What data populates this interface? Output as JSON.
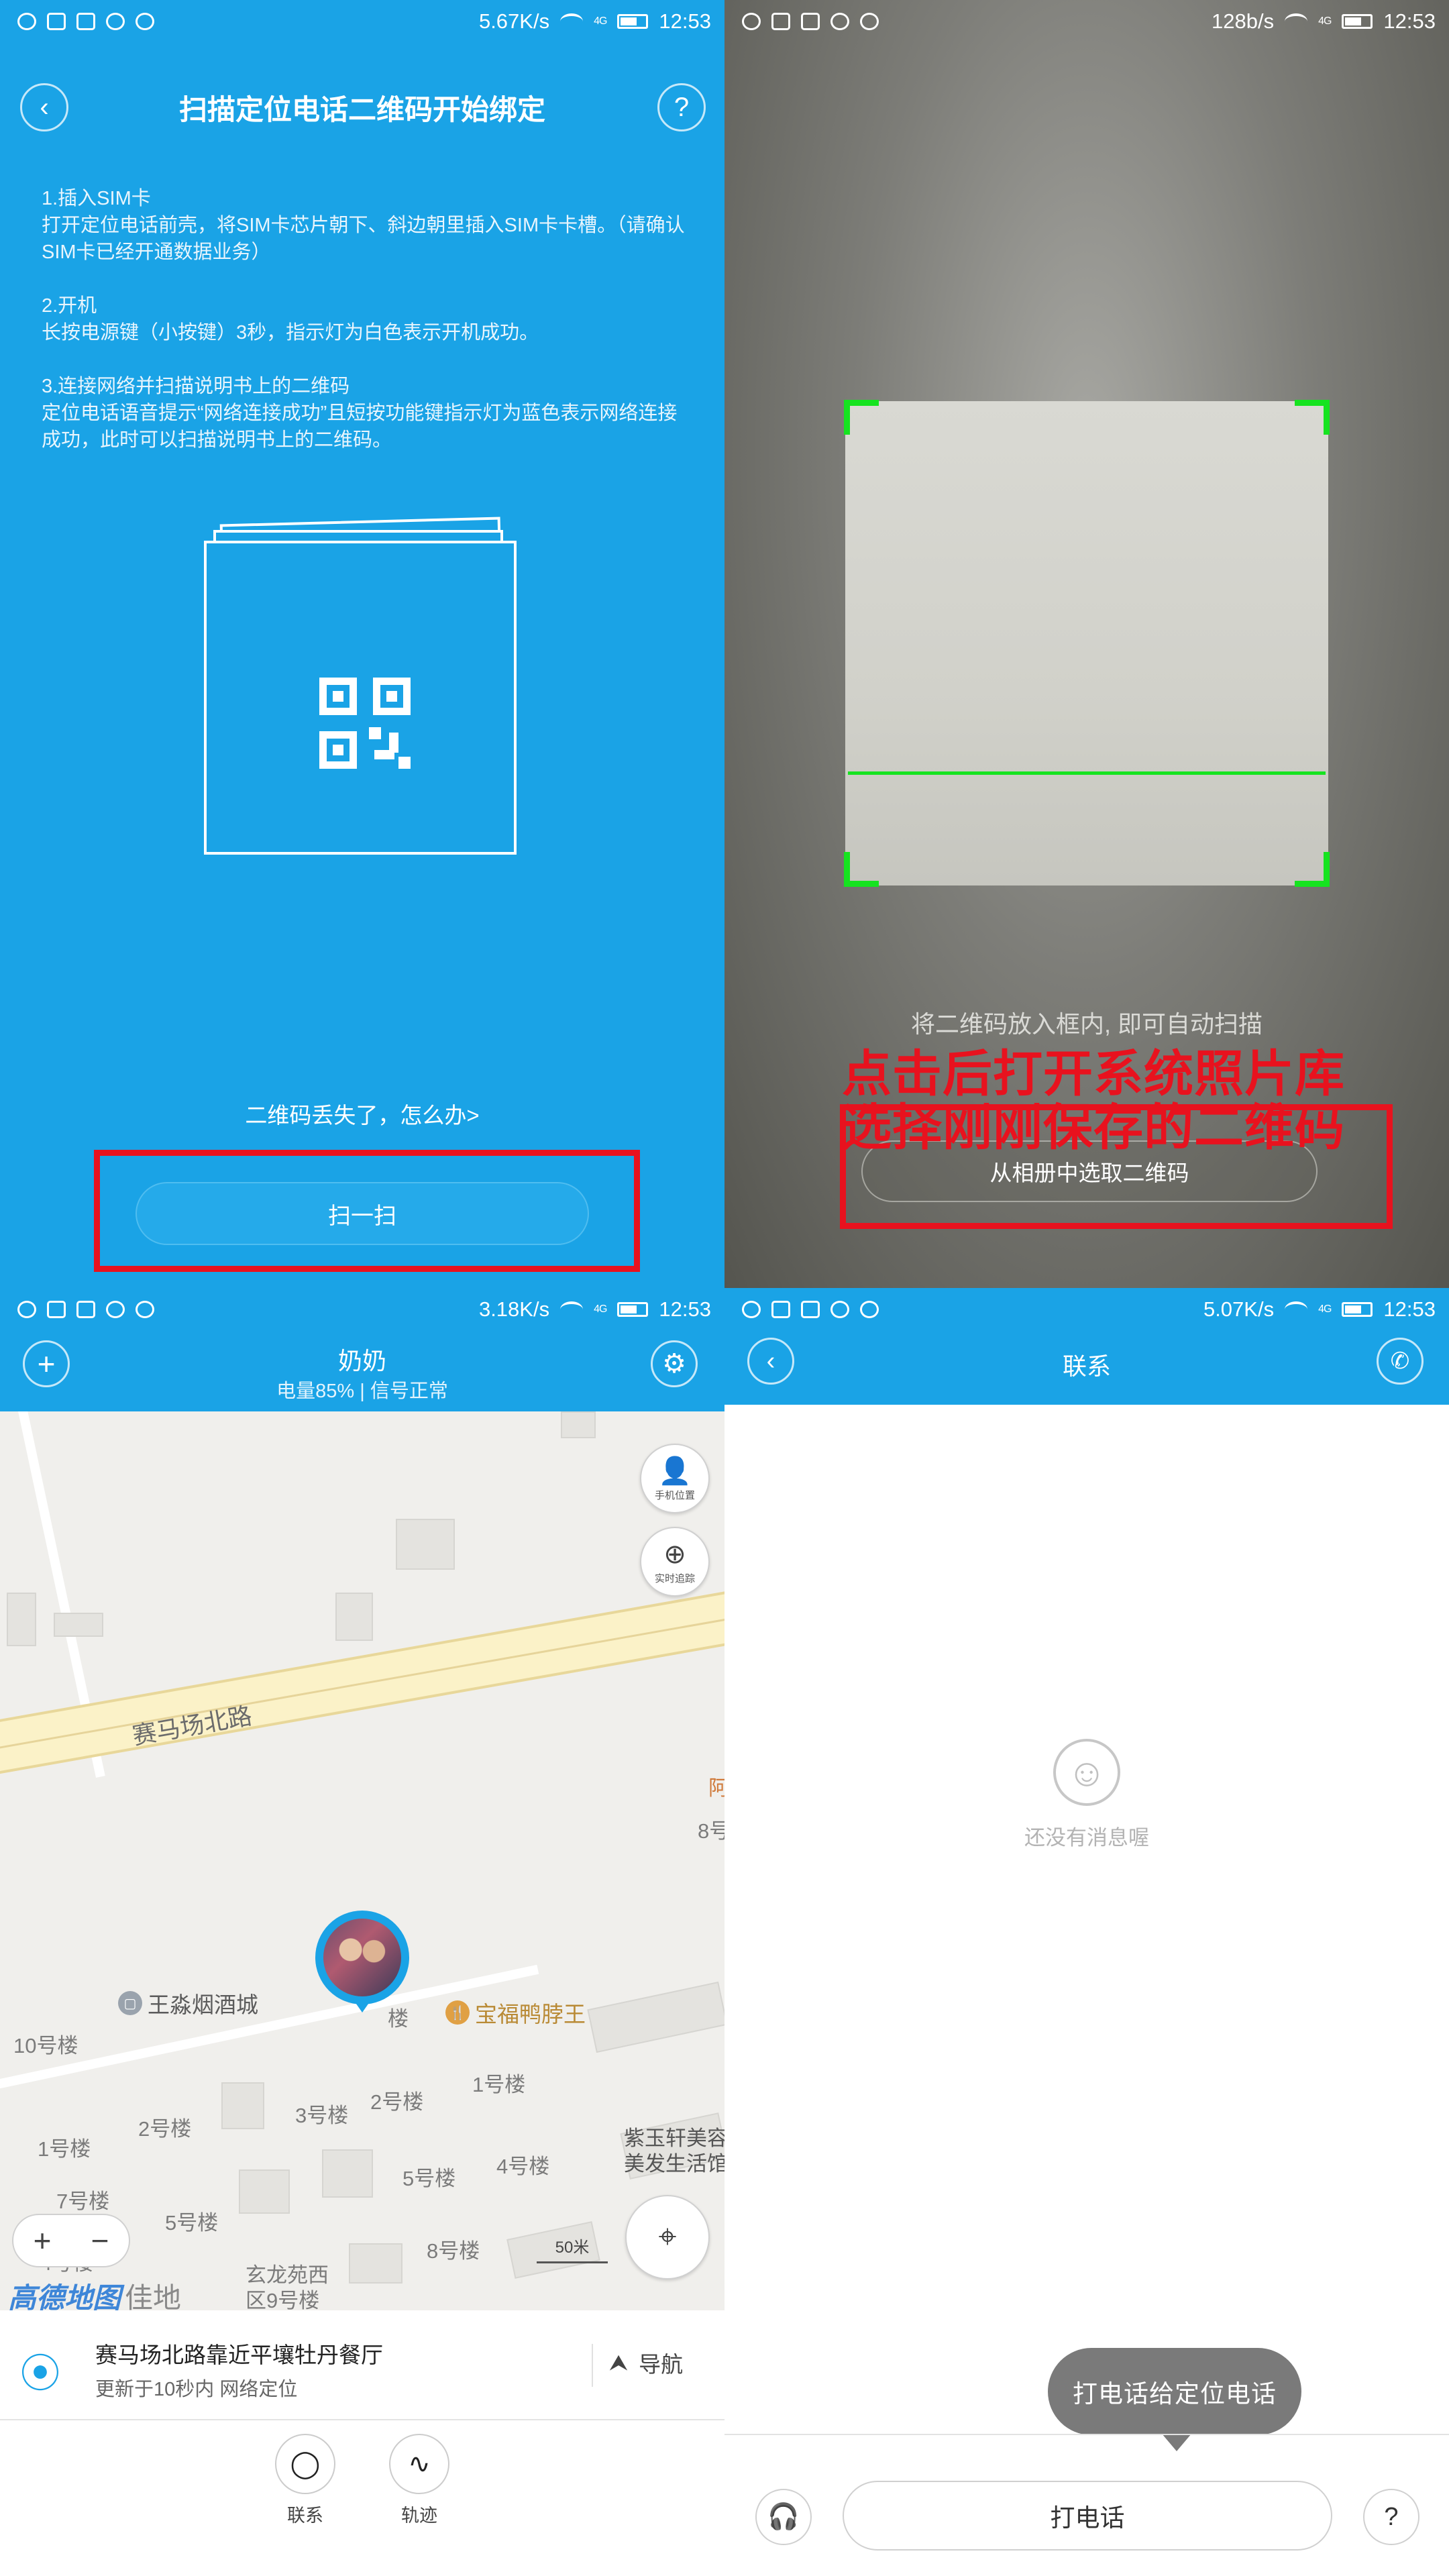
{
  "status_bars": [
    {
      "speed": "5.67K/s",
      "network": "4G",
      "time": "12:53"
    },
    {
      "speed": "128b/s",
      "network": "4G",
      "time": "12:53"
    },
    {
      "speed": "3.18K/s",
      "network": "4G",
      "time": "12:53"
    },
    {
      "speed": "5.07K/s",
      "network": "4G",
      "time": "12:53"
    }
  ],
  "bind_screen": {
    "title": "扫描定位电话二维码开始绑定",
    "back_icon": "chevron-left-icon",
    "help_label": "?",
    "steps": [
      {
        "heading": "1.插入SIM卡",
        "body": "打开定位电话前壳，将SIM卡芯片朝下、斜边朝里插入SIM卡卡槽。（请确认SIM卡已经开通数据业务）"
      },
      {
        "heading": "2.开机",
        "body": "长按电源键（小按键）3秒，指示灯为白色表示开机成功。"
      },
      {
        "heading": "3.连接网络并扫描说明书上的二维码",
        "body": "定位电话语音提示“网络连接成功”且短按功能键指示灯为蓝色表示网络连接成功，此时可以扫描说明书上的二维码。"
      }
    ],
    "lost_link": "二维码丢失了，怎么办>",
    "scan_button": "扫一扫",
    "accent_color": "#1aa3e6",
    "highlight_color": "#e8121e"
  },
  "scan_screen": {
    "hint": "将二维码放入框内, 即可自动扫描",
    "annotation_line1": "点击后打开系统照片库",
    "annotation_line2": "选择刚刚保存的二维码",
    "album_button": "从相册中选取二维码",
    "frame_color": "#16e320"
  },
  "map_screen": {
    "name": "奶奶",
    "battery_signal": "电量85% | 信号正常",
    "phone_location_label": "手机位置",
    "tracking_label": "实时追踪",
    "road_name": "赛马场北路",
    "pois": [
      "王淼烟酒城",
      "宝福鸭脖王"
    ],
    "building_labels": [
      "10号楼",
      "3号楼",
      "2号楼",
      "1号楼",
      "1号楼",
      "2号楼",
      "5号楼",
      "4号楼",
      "5号楼",
      "4号楼",
      "8号楼",
      "玄龙苑西",
      "区9号楼",
      "7号楼",
      "紫玉轩美容",
      "美发生活馆",
      "8号",
      "阿",
      "楼"
    ],
    "zoom_in": "+",
    "zoom_out": "−",
    "scale": "50米",
    "map_logo": "高德地图",
    "map_logo_tail": "佳地",
    "address": "赛马场北路靠近平壤牡丹餐厅",
    "update_info": "更新于10秒内  网络定位",
    "nav_label": "导航",
    "bottom_nav": [
      {
        "label": "联系",
        "icon": "chat-bubble-icon"
      },
      {
        "label": "轨迹",
        "icon": "track-icon"
      }
    ]
  },
  "contact_screen": {
    "title": "联系",
    "empty_text": "还没有消息喔",
    "tooltip": "打电话给定位电话",
    "call_button": "打电话"
  }
}
